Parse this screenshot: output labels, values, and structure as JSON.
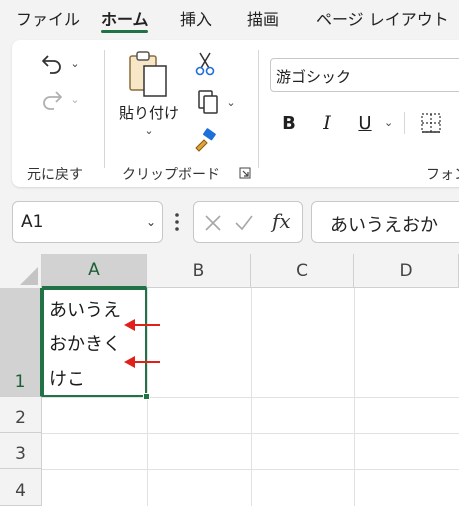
{
  "tabs": [
    {
      "label": "ファイル",
      "active": false
    },
    {
      "label": "ホーム",
      "active": true
    },
    {
      "label": "挿入",
      "active": false
    },
    {
      "label": "描画",
      "active": false
    },
    {
      "label": "ページ レイアウト",
      "active": false
    }
  ],
  "ribbon": {
    "undo_group_label": "元に戻す",
    "clipboard_group_label": "クリップボード",
    "paste_label": "貼り付け",
    "font_name": "游ゴシック",
    "font_group_label": "フォン",
    "bold_label": "B",
    "italic_label": "I",
    "underline_label": "U"
  },
  "formula_bar": {
    "name_box": "A1",
    "fx_label": "fx",
    "formula_value": "あいうえおか"
  },
  "sheet": {
    "columns": [
      "A",
      "B",
      "C",
      "D"
    ],
    "rows": [
      "1",
      "2",
      "3",
      "4"
    ],
    "selected_cell": "A1",
    "a1_lines": [
      "あいうえ",
      "おかきく",
      "けこ"
    ]
  },
  "colors": {
    "accent": "#217346",
    "arrow": "#e0201b"
  }
}
